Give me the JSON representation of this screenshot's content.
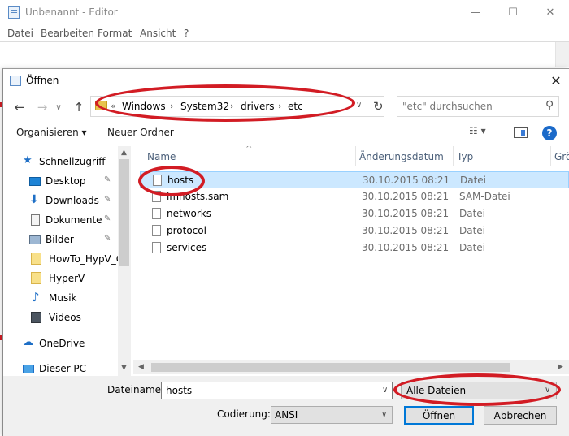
{
  "editor": {
    "title": "Unbenannt - Editor",
    "minimize": "—",
    "maximize": "☐",
    "close": "✕",
    "menu": [
      "Datei",
      "Bearbeiten",
      "Format",
      "Ansicht",
      "?"
    ]
  },
  "dialog": {
    "title": "Öffnen",
    "close": "✕",
    "address": {
      "more": "«",
      "crumbs": [
        "Windows",
        "System32",
        "drivers",
        "etc"
      ],
      "separator": "›",
      "dropdown": "∨",
      "refresh": "↻"
    },
    "nav": {
      "back": "←",
      "forward": "→",
      "history": "∨",
      "up": "↑"
    },
    "search": {
      "placeholder": "\"etc\" durchsuchen",
      "icon": "⚲"
    },
    "toolbar": {
      "organize": "Organisieren ▾",
      "new_folder": "Neuer Ordner",
      "view": "☷ ▾",
      "help": "?"
    },
    "nav_pane": {
      "items": [
        {
          "label": "Schnellzugriff",
          "icon": "star-icon",
          "pin": ""
        },
        {
          "label": "Desktop",
          "icon": "desktop-icon",
          "pin": "✎"
        },
        {
          "label": "Downloads",
          "icon": "download-icon",
          "pin": "✎"
        },
        {
          "label": "Dokumente",
          "icon": "document-icon",
          "pin": "✎"
        },
        {
          "label": "Bilder",
          "icon": "pictures-icon",
          "pin": "✎"
        },
        {
          "label": "HowTo_HypV_G",
          "icon": "folder-icon",
          "pin": ""
        },
        {
          "label": "HyperV",
          "icon": "folder-icon",
          "pin": ""
        },
        {
          "label": "Musik",
          "icon": "music-icon",
          "pin": ""
        },
        {
          "label": "Videos",
          "icon": "video-icon",
          "pin": ""
        },
        {
          "label": "OneDrive",
          "icon": "cloud-icon",
          "pin": ""
        },
        {
          "label": "Dieser PC",
          "icon": "computer-icon",
          "pin": ""
        }
      ]
    },
    "columns": {
      "name": "Name",
      "date": "Änderungsdatum",
      "type": "Typ",
      "size": "Grö",
      "sort_caret": "^"
    },
    "files": [
      {
        "name": "hosts",
        "date": "30.10.2015 08:21",
        "type": "Datei"
      },
      {
        "name": "lmhosts.sam",
        "date": "30.10.2015 08:21",
        "type": "SAM-Datei"
      },
      {
        "name": "networks",
        "date": "30.10.2015 08:21",
        "type": "Datei"
      },
      {
        "name": "protocol",
        "date": "30.10.2015 08:21",
        "type": "Datei"
      },
      {
        "name": "services",
        "date": "30.10.2015 08:21",
        "type": "Datei"
      }
    ],
    "bottom": {
      "filename_label": "Dateiname:",
      "filename_value": "hosts",
      "filter_value": "Alle Dateien",
      "encoding_label": "Codierung:",
      "encoding_value": "ANSI",
      "open_label": "Öffnen",
      "cancel_label": "Abbrechen",
      "combo_arrow": "∨"
    }
  },
  "colors": {
    "annotation_red": "#d21c24",
    "selection": "#cce8ff",
    "accent": "#0078d7"
  }
}
